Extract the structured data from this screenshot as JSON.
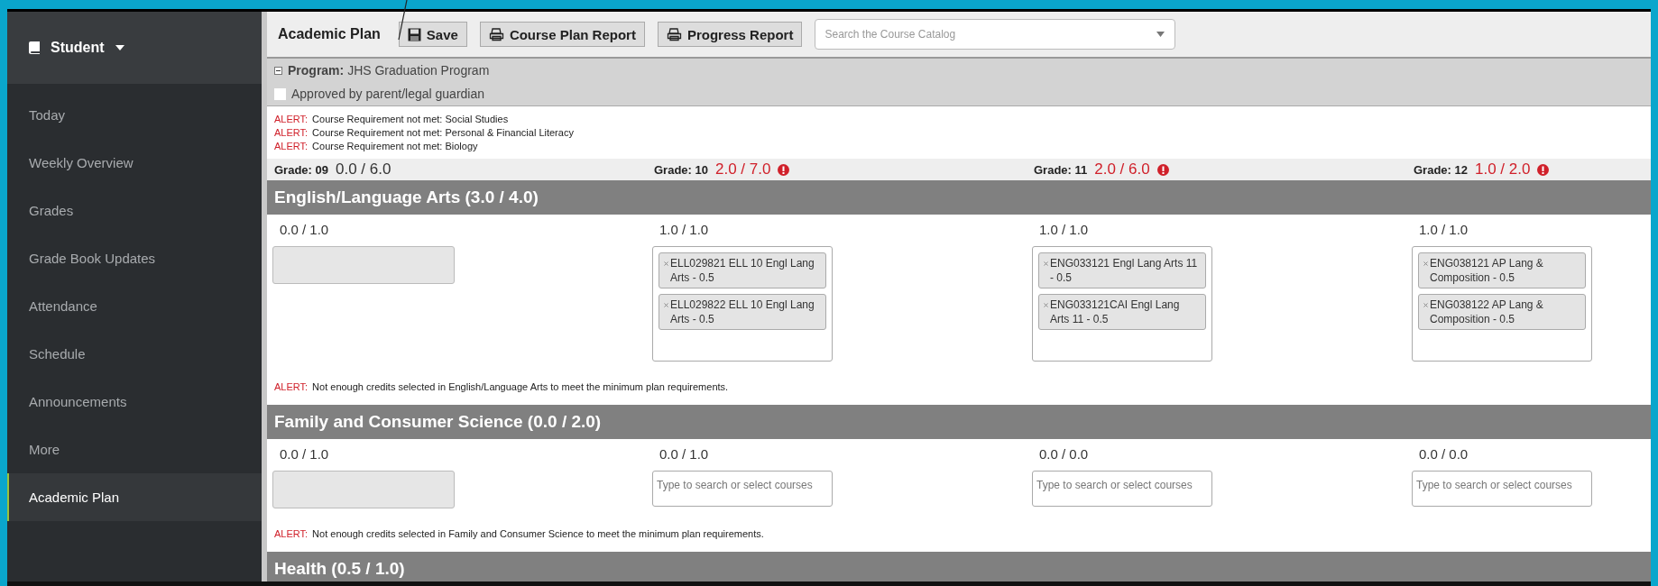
{
  "sidebar": {
    "header": "Student",
    "items": [
      {
        "label": "Today",
        "selected": false
      },
      {
        "label": "Weekly Overview",
        "selected": false
      },
      {
        "label": "Grades",
        "selected": false
      },
      {
        "label": "Grade Book Updates",
        "selected": false
      },
      {
        "label": "Attendance",
        "selected": false
      },
      {
        "label": "Schedule",
        "selected": false
      },
      {
        "label": "Announcements",
        "selected": false
      },
      {
        "label": "More",
        "selected": false
      },
      {
        "label": "Academic Plan",
        "selected": true
      }
    ]
  },
  "toolbar": {
    "title": "Academic Plan",
    "buttons": [
      {
        "label": "Save",
        "kind": "save"
      },
      {
        "label": "Course Plan Report",
        "kind": "print"
      },
      {
        "label": "Progress Report",
        "kind": "print"
      }
    ],
    "search": {
      "placeholder": "Search the Course Catalog"
    }
  },
  "program": {
    "label": "Program:",
    "name": "JHS Graduation Program",
    "expanded": true
  },
  "approval": {
    "label": "Approved by parent/legal guardian",
    "checked": false
  },
  "alerts": [
    {
      "tag": "ALERT:",
      "text": "Course Requirement not met: Social Studies"
    },
    {
      "tag": "ALERT:",
      "text": "Course Requirement not met: Personal & Financial Literacy"
    },
    {
      "tag": "ALERT:",
      "text": "Course Requirement not met: Biology"
    }
  ],
  "grades": [
    {
      "label": "Grade: 09",
      "credits": "0.0 / 6.0",
      "warning": false
    },
    {
      "label": "Grade: 10",
      "credits": "2.0 / 7.0",
      "warning": true
    },
    {
      "label": "Grade: 11",
      "credits": "2.0 / 6.0",
      "warning": true
    },
    {
      "label": "Grade: 12",
      "credits": "1.0 / 2.0",
      "warning": true
    }
  ],
  "sections": [
    {
      "title": "English/Language Arts (3.0 / 4.0)",
      "columns": [
        {
          "credits": "0.0 / 1.0",
          "kind": "empty"
        },
        {
          "credits": "1.0 / 1.0",
          "kind": "courses",
          "courses": [
            "ELL029821 ELL 10 Engl Lang Arts - 0.5",
            "ELL029822 ELL 10 Engl Lang Arts - 0.5"
          ]
        },
        {
          "credits": "1.0 / 1.0",
          "kind": "courses",
          "courses": [
            "ENG033121 Engl Lang Arts 11 - 0.5",
            "ENG033121CAI Engl Lang Arts 11 - 0.5"
          ]
        },
        {
          "credits": "1.0 / 1.0",
          "kind": "courses",
          "courses": [
            "ENG038121 AP Lang & Composition - 0.5",
            "ENG038122 AP Lang & Composition - 0.5"
          ]
        }
      ],
      "alert": {
        "tag": "ALERT:",
        "text": "Not enough credits selected in English/Language Arts to meet the minimum plan requirements."
      }
    },
    {
      "title": "Family and Consumer Science (0.0 / 2.0)",
      "columns": [
        {
          "credits": "0.0 / 1.0",
          "kind": "empty"
        },
        {
          "credits": "0.0 / 1.0",
          "kind": "search",
          "placeholder": "Type to search or select courses"
        },
        {
          "credits": "0.0 / 0.0",
          "kind": "search",
          "placeholder": "Type to search or select courses"
        },
        {
          "credits": "0.0 / 0.0",
          "kind": "search",
          "placeholder": "Type to search or select courses"
        }
      ],
      "alert": {
        "tag": "ALERT:",
        "text": "Not enough credits selected in Family and Consumer Science to meet the minimum plan requirements."
      }
    },
    {
      "title": "Health (0.5 / 1.0)"
    }
  ]
}
